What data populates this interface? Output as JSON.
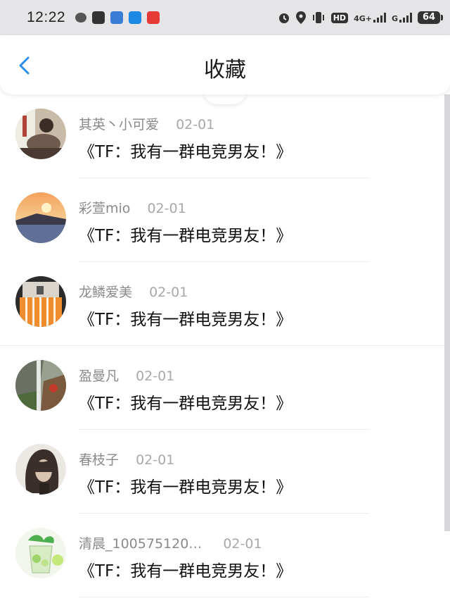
{
  "status_bar": {
    "time": "12:22",
    "network_label": "4G+",
    "signal_label": "G",
    "hd_label": "HD",
    "battery": "64"
  },
  "header": {
    "title": "收藏"
  },
  "favorites": [
    {
      "user": "其英丶小可爱",
      "date": "02-01",
      "title": "《TF：我有一群电竞男友！》"
    },
    {
      "user": "彩萱mio",
      "date": "02-01",
      "title": "《TF：我有一群电竞男友！》"
    },
    {
      "user": "龙鳞爱美",
      "date": "02-01",
      "title": "《TF：我有一群电竞男友！》"
    },
    {
      "user": "盈曼凡",
      "date": "02-01",
      "title": "《TF：我有一群电竞男友！》"
    },
    {
      "user": "春枝子",
      "date": "02-01",
      "title": "《TF：我有一群电竞男友！》"
    },
    {
      "user": "清晨_100575120…",
      "date": "02-01",
      "title": "《TF：我有一群电竞男友！》"
    }
  ],
  "colors": {
    "accent": "#2a8fe8",
    "status_bar_bg": "#e5e5e7"
  }
}
